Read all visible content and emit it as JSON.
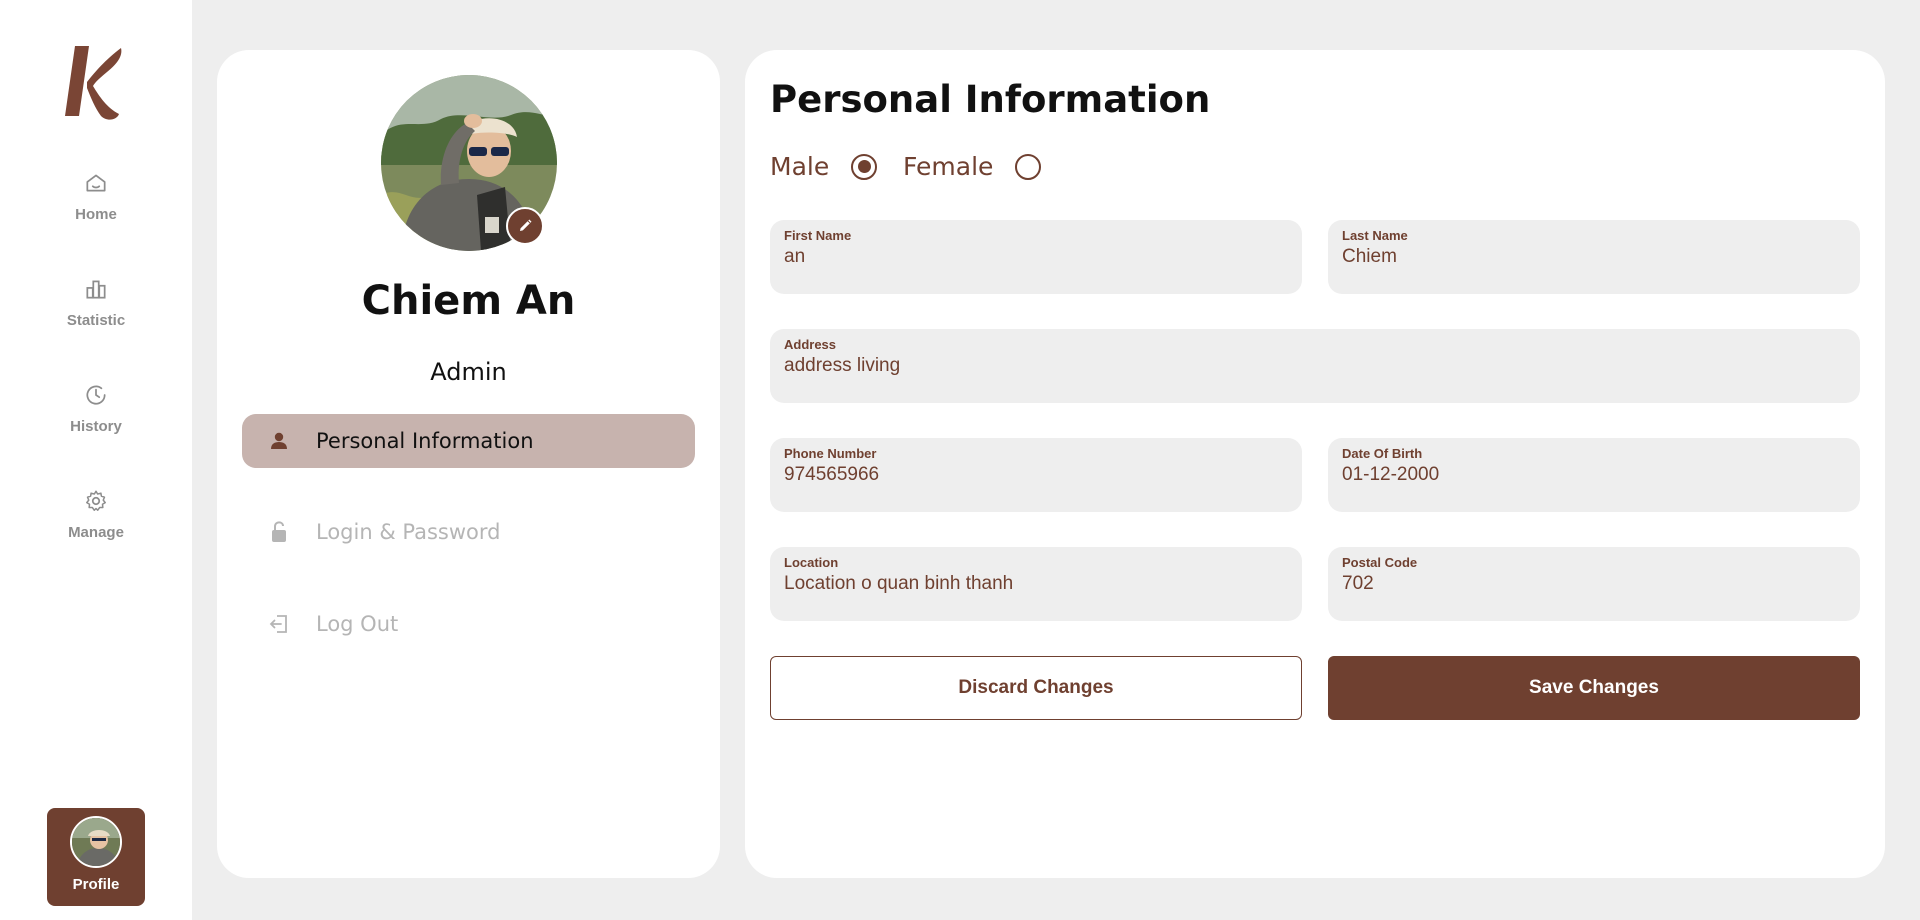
{
  "sidebar": {
    "logo_text": "K",
    "items": [
      {
        "label": "Home",
        "icon": "home-icon"
      },
      {
        "label": "Statistic",
        "icon": "bar-chart-icon"
      },
      {
        "label": "History",
        "icon": "clock-icon"
      },
      {
        "label": "Manage",
        "icon": "gear-icon"
      }
    ],
    "profile_label": "Profile"
  },
  "profile": {
    "name": "Chiem An",
    "role": "Admin",
    "menu": [
      {
        "label": "Personal Information",
        "icon": "person-icon",
        "active": true
      },
      {
        "label": "Login & Password",
        "icon": "unlock-icon",
        "active": false
      },
      {
        "label": "Log Out",
        "icon": "logout-icon",
        "active": false
      }
    ]
  },
  "form": {
    "title": "Personal Information",
    "gender": {
      "male_label": "Male",
      "female_label": "Female",
      "selected": "Male"
    },
    "first_name": {
      "label": "First Name",
      "value": "an"
    },
    "last_name": {
      "label": "Last Name",
      "value": "Chiem"
    },
    "address": {
      "label": "Address",
      "value": "address living"
    },
    "phone": {
      "label": "Phone Number",
      "value": "974565966"
    },
    "dob": {
      "label": "Date Of Birth",
      "value": "01-12-2000"
    },
    "location": {
      "label": "Location",
      "value": "Location o quan binh thanh"
    },
    "postal_code": {
      "label": "Postal Code",
      "value": "702"
    },
    "discard_label": "Discard Changes",
    "save_label": "Save Changes"
  },
  "colors": {
    "brand": "#6f4030",
    "active_menu_bg": "#c7b3ae",
    "page_bg": "#eeeeee",
    "field_bg": "#eeeeee",
    "muted_text": "#b5b5b5"
  }
}
